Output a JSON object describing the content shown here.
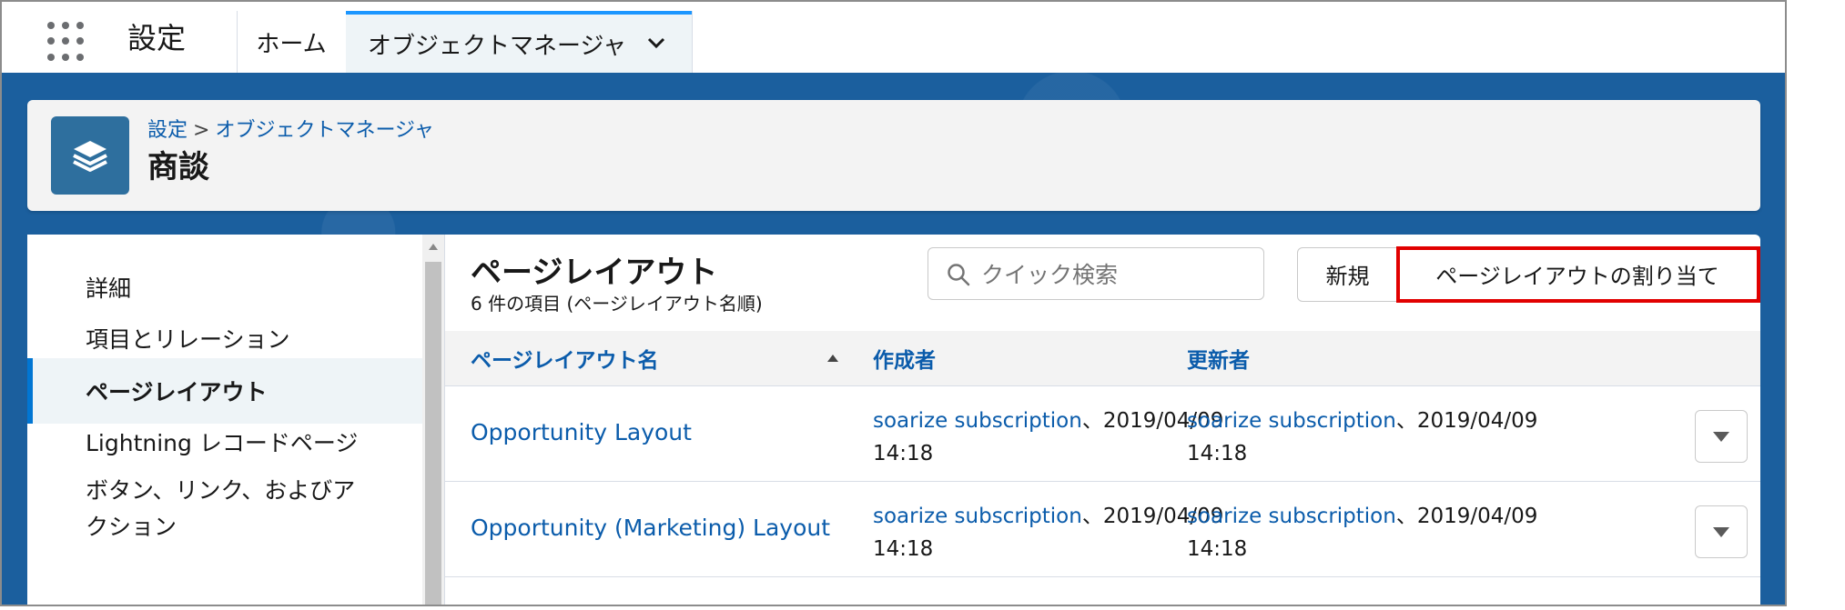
{
  "nav": {
    "app_name": "設定",
    "home_label": "ホーム",
    "active_tab_label": "オブジェクトマネージャ"
  },
  "header": {
    "breadcrumb_root": "設定",
    "breadcrumb_sep": ">",
    "breadcrumb_current": "オブジェクトマネージャ",
    "object_title": "商談"
  },
  "sidebar": {
    "items": [
      {
        "label": "詳細"
      },
      {
        "label": "項目とリレーション"
      },
      {
        "label": "ページレイアウト"
      },
      {
        "label": "Lightning レコードページ"
      },
      {
        "label": "ボタン、リンク、およびア\nクション"
      }
    ]
  },
  "section": {
    "title": "ページレイアウト",
    "subtitle": "6 件の項目 (ページレイアウト名順)",
    "search_placeholder": "クイック検索",
    "new_button": "新規",
    "assign_button": "ページレイアウトの割り当て"
  },
  "table": {
    "columns": [
      "ページレイアウト名",
      "作成者",
      "更新者"
    ],
    "rows": [
      {
        "name": "Opportunity Layout",
        "created_user": "soarize subscription",
        "created_date": "、2019/04/09",
        "created_time": "14:18",
        "modified_user": "soarize subscription",
        "modified_date": "、2019/04/09",
        "modified_time": "14:18"
      },
      {
        "name": "Opportunity (Marketing) Layout",
        "created_user": "soarize subscription",
        "created_date": "、2019/04/09",
        "created_time": "14:18",
        "modified_user": "soarize subscription",
        "modified_date": "、2019/04/09",
        "modified_time": "14:18"
      }
    ]
  },
  "colors": {
    "brand_blue": "#0176d3",
    "link_blue": "#0b5cab",
    "highlight_red": "#e10000",
    "background_blue": "#1b5f9e"
  },
  "icons": {
    "app_launcher": "waffle-icon",
    "tab_chevron": "chevron-down-icon",
    "object": "stack-icon",
    "search": "search-icon",
    "sort": "sort-up-icon",
    "row_action": "dropdown-icon"
  }
}
